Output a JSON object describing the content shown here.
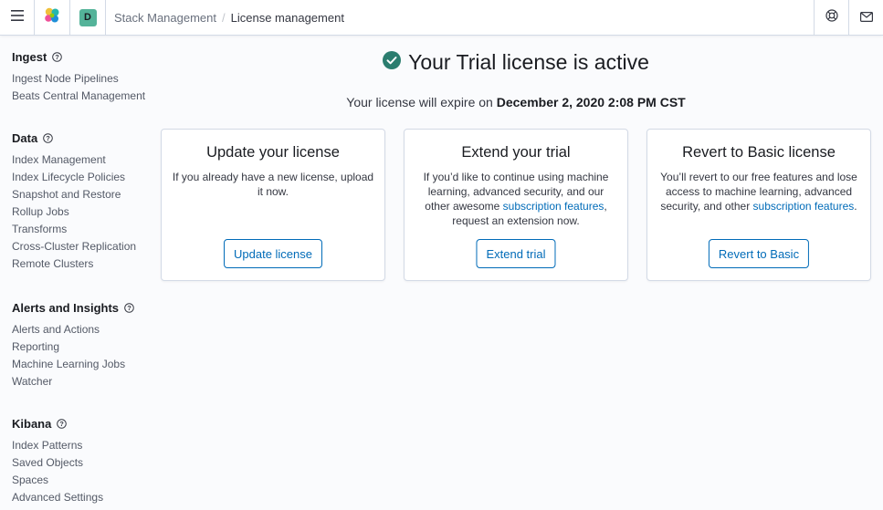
{
  "header": {
    "breadcrumbs": [
      "Stack Management",
      "License management"
    ],
    "space_initial": "D",
    "icons": [
      "menu-icon",
      "elastic-logo-icon",
      "help-icon",
      "mail-icon"
    ]
  },
  "sidebar": {
    "groups": [
      {
        "title": "Ingest",
        "items": [
          "Ingest Node Pipelines",
          "Beats Central Management"
        ]
      },
      {
        "title": "Data",
        "items": [
          "Index Management",
          "Index Lifecycle Policies",
          "Snapshot and Restore",
          "Rollup Jobs",
          "Transforms",
          "Cross-Cluster Replication",
          "Remote Clusters"
        ]
      },
      {
        "title": "Alerts and Insights",
        "items": [
          "Alerts and Actions",
          "Reporting",
          "Machine Learning Jobs",
          "Watcher"
        ]
      },
      {
        "title": "Kibana",
        "items": [
          "Index Patterns",
          "Saved Objects",
          "Spaces",
          "Advanced Settings"
        ]
      }
    ]
  },
  "main": {
    "title": "Your Trial license is active",
    "expire_prefix": "Your license will expire on ",
    "expire_date": "December 2, 2020 2:08 PM CST",
    "cards": [
      {
        "title": "Update your license",
        "desc_before": "If you already have a new license, upload it now.",
        "link": "",
        "desc_after": "",
        "button": "Update license"
      },
      {
        "title": "Extend your trial",
        "desc_before": "If you’d like to continue using machine learning, advanced security, and our other awesome ",
        "link": "subscription features",
        "desc_after": ", request an extension now.",
        "button": "Extend trial"
      },
      {
        "title": "Revert to Basic license",
        "desc_before": "You’ll revert to our free features and lose access to machine learning, advanced security, and other ",
        "link": "subscription features",
        "desc_after": ".",
        "button": "Revert to Basic"
      }
    ]
  },
  "colors": {
    "accent": "#006bb8",
    "success": "#2b7d6f",
    "avatar": "#54b399"
  }
}
